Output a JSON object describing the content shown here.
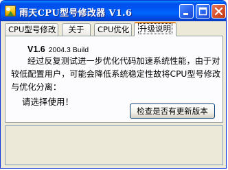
{
  "window": {
    "title": "雨天CPU型号修改器 V1.6",
    "controls": [
      "minimize",
      "maximize",
      "close"
    ]
  },
  "tabs": [
    {
      "label": "CPU型号修改"
    },
    {
      "label": "关于"
    },
    {
      "label": "CPU优化"
    },
    {
      "label": "升级说明",
      "active": true
    }
  ],
  "panel": {
    "version": "V1.6",
    "build": "2004.3 Build",
    "description": "经过反复测试进一步优化代码加速系统性能，由于对较低配置用户，可能会降低系统稳定性故将CPU型号修改与优化分离：",
    "prompt": "请选择使用！",
    "update_button": "检查是否有更新版本"
  },
  "icons": {
    "app": "app-landscape-icon",
    "minimize": "minimize-icon",
    "maximize": "maximize-icon",
    "close": "close-icon"
  },
  "colors": {
    "titlebar": "#0054e3",
    "close_button": "#d8532e",
    "active_tab_accent": "#e68b2c"
  }
}
